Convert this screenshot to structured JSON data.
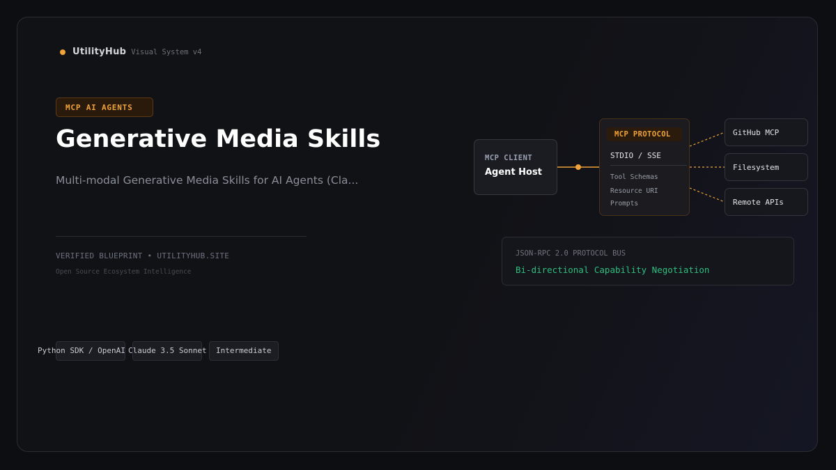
{
  "brand": {
    "name": "UtilityHub",
    "sub": "Visual System v4"
  },
  "hero": {
    "badge": "MCP AI AGENTS",
    "title": "Generative Media Skills",
    "subtitle": "Multi-modal Generative Media Skills for AI Agents (Cla...",
    "verified": "VERIFIED BLUEPRINT • UTILITYHUB.SITE",
    "ecosystem": "Open Source Ecosystem Intelligence"
  },
  "tags": [
    "Python SDK / OpenAI",
    "Claude 3.5 Sonnet",
    "Intermediate"
  ],
  "diagram": {
    "client": {
      "label": "MCP CLIENT",
      "name": "Agent Host"
    },
    "protocol": {
      "header": "MCP PROTOCOL",
      "transport": "STDIO / SSE",
      "items": [
        "Tool Schemas",
        "Resource URI",
        "Prompts"
      ]
    },
    "servers": [
      "GitHub MCP",
      "Filesystem",
      "Remote APIs"
    ],
    "bus": {
      "label": "JSON-RPC 2.0 PROTOCOL BUS",
      "text": "Bi-directional Capability Negotiation"
    }
  },
  "colors": {
    "accent": "#f0a33a",
    "success": "#2fbf7f",
    "background": "#0d0e12"
  }
}
